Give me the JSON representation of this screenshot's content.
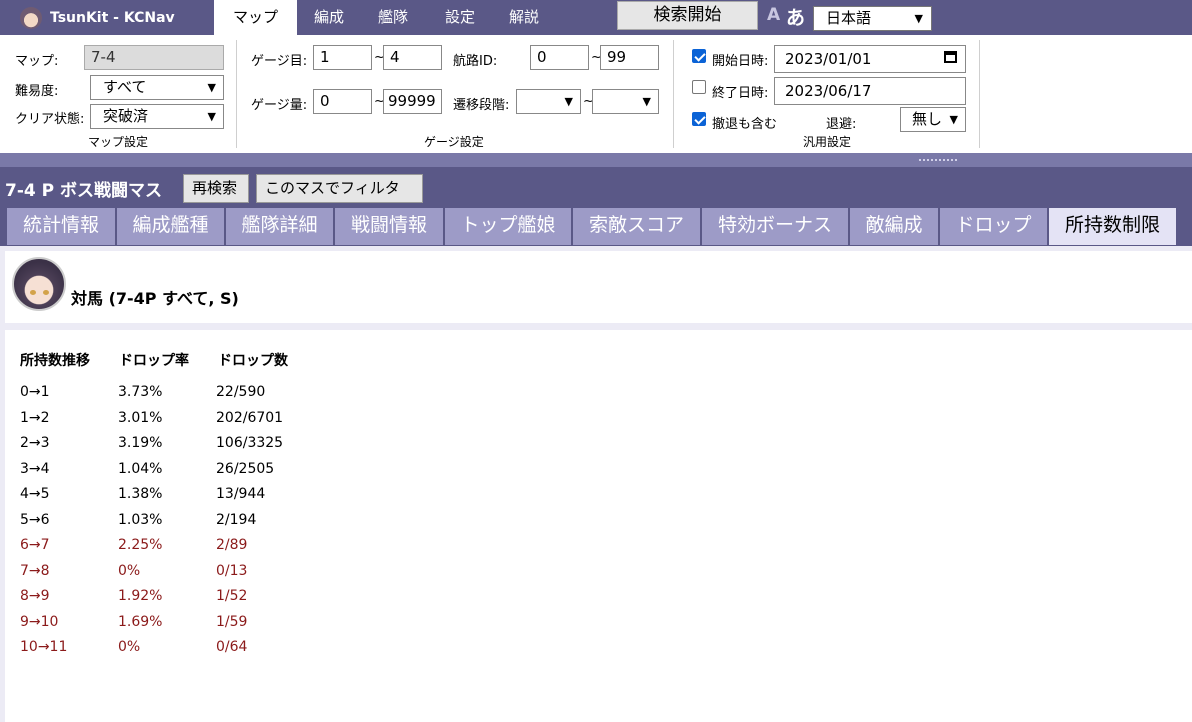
{
  "app": {
    "brand": "TsunKit - KCNav"
  },
  "nav": {
    "tabs": [
      {
        "label": "マップ",
        "active": true
      },
      {
        "label": "編成",
        "active": false
      },
      {
        "label": "艦隊",
        "active": false
      },
      {
        "label": "設定",
        "active": false
      },
      {
        "label": "解説",
        "active": false
      }
    ],
    "search_button": "検索開始",
    "font_small": "A",
    "font_large": "あ",
    "language": "日本語"
  },
  "map_settings": {
    "map_label": "マップ:",
    "map_value": "7-4",
    "difficulty_label": "難易度:",
    "difficulty_value": "すべて",
    "clear_label": "クリア状態:",
    "clear_value": "突破済",
    "group_label": "マップ設定"
  },
  "gauge_settings": {
    "gauge_num_label": "ゲージ目:",
    "gauge_num_from": "1",
    "gauge_num_to": "4",
    "route_label": "航路ID:",
    "route_from": "0",
    "route_to": "99",
    "gauge_amount_label": "ゲージ量:",
    "gauge_amount_from": "0",
    "gauge_amount_to": "99999",
    "phase_label": "遷移段階:",
    "phase_from": "",
    "phase_to": "",
    "tilde": "~",
    "group_label": "ゲージ設定"
  },
  "general_settings": {
    "start_label": "開始日時:",
    "start_checked": true,
    "start_value": "2023/01/01",
    "end_label": "終了日時:",
    "end_checked": false,
    "end_value": "2023/06/17",
    "retreat_label": "撤退も含む",
    "retreat_checked": true,
    "evade_label": "退避:",
    "evade_value": "無し",
    "group_label": "汎用設定"
  },
  "node": {
    "title": "7-4 P ボス戦闘マス",
    "research_button": "再検索",
    "filter_button": "このマスでフィルタ"
  },
  "result_tabs": [
    {
      "label": "統計情報",
      "active": false
    },
    {
      "label": "編成艦種",
      "active": false
    },
    {
      "label": "艦隊詳細",
      "active": false
    },
    {
      "label": "戦闘情報",
      "active": false
    },
    {
      "label": "トップ艦娘",
      "active": false
    },
    {
      "label": "索敵スコア",
      "active": false
    },
    {
      "label": "特効ボーナス",
      "active": false
    },
    {
      "label": "敵編成",
      "active": false
    },
    {
      "label": "ドロップ",
      "active": false
    },
    {
      "label": "所持数制限",
      "active": true
    }
  ],
  "ship": {
    "name": "対馬 (7-4P すべて, S)"
  },
  "table": {
    "headers": [
      "所持数推移",
      "ドロップ率",
      "ドロップ数"
    ],
    "highlight_color": "#8b1a1a",
    "rows": [
      {
        "transition": "0→1",
        "rate": "3.73%",
        "count": "22/590",
        "highlight": false
      },
      {
        "transition": "1→2",
        "rate": "3.01%",
        "count": "202/6701",
        "highlight": false
      },
      {
        "transition": "2→3",
        "rate": "3.19%",
        "count": "106/3325",
        "highlight": false
      },
      {
        "transition": "3→4",
        "rate": "1.04%",
        "count": "26/2505",
        "highlight": false
      },
      {
        "transition": "4→5",
        "rate": "1.38%",
        "count": "13/944",
        "highlight": false
      },
      {
        "transition": "5→6",
        "rate": "1.03%",
        "count": "2/194",
        "highlight": false
      },
      {
        "transition": "6→7",
        "rate": "2.25%",
        "count": "2/89",
        "highlight": true
      },
      {
        "transition": "7→8",
        "rate": "0%",
        "count": "0/13",
        "highlight": true
      },
      {
        "transition": "8→9",
        "rate": "1.92%",
        "count": "1/52",
        "highlight": true
      },
      {
        "transition": "9→10",
        "rate": "1.69%",
        "count": "1/59",
        "highlight": true
      },
      {
        "transition": "10→11",
        "rate": "0%",
        "count": "0/64",
        "highlight": true
      }
    ]
  }
}
